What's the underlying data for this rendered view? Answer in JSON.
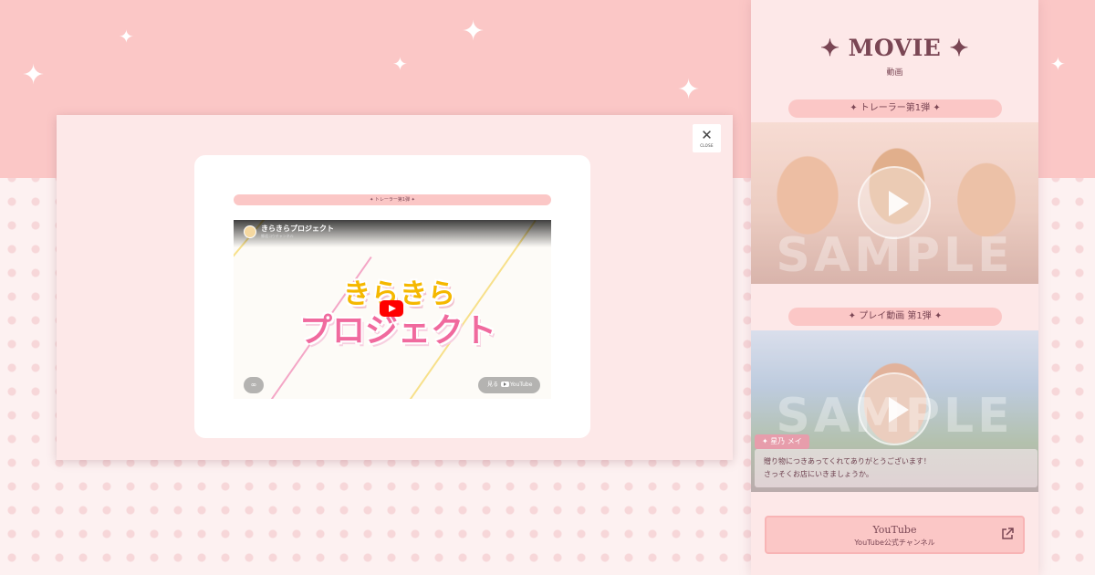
{
  "side": {
    "title": "✦ MOVIE ✦",
    "subtitle": "動画",
    "videos": [
      {
        "label": "✦ トレーラー第1弾 ✦",
        "watermark": "SAMPLE"
      },
      {
        "label": "✦ プレイ動画 第1弾 ✦",
        "watermark": "SAMPLE",
        "dialog_name": "✦ 星乃 メイ",
        "dialog_line1": "贈り物につきあってくれてありがとうございます！",
        "dialog_line2": "さっそくお店にいきましょうか。"
      }
    ],
    "youtube": {
      "title": "YouTube",
      "subtitle": "YouTube公式チャンネル",
      "icon": "external-link-icon"
    }
  },
  "modal": {
    "close": {
      "icon": "close-icon",
      "label": "CLOSE"
    },
    "video_label": "✦ トレーラー第1弾 ✦",
    "player": {
      "channel_title": "きらきらプロジェクト",
      "channel_sub": "郷遥コウチャンネル",
      "logo_line1": "きらきら",
      "logo_line2": "プロジェクト",
      "link_icon": "link-icon",
      "watch_prefix": "見る",
      "watch_brand": "YouTube"
    }
  },
  "colors": {
    "band": "#fbc7c6",
    "panel": "#fde8e8",
    "accent_text": "#7a4654",
    "youtube_red": "#ff0000"
  }
}
